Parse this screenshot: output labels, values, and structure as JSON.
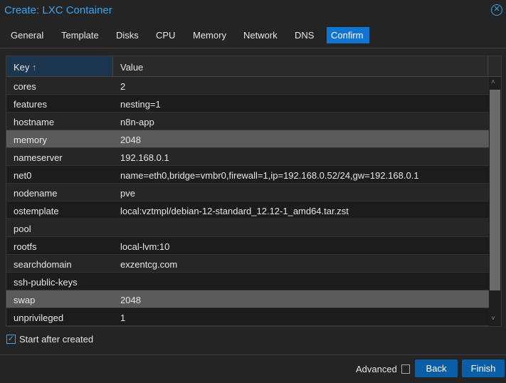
{
  "title": "Create: LXC Container",
  "tabs": [
    "General",
    "Template",
    "Disks",
    "CPU",
    "Memory",
    "Network",
    "DNS",
    "Confirm"
  ],
  "grid": {
    "key_header": "Key",
    "value_header": "Value",
    "sort_icon": "↑",
    "rows": [
      {
        "key": "cores",
        "value": "2"
      },
      {
        "key": "features",
        "value": "nesting=1"
      },
      {
        "key": "hostname",
        "value": "n8n-app"
      },
      {
        "key": "memory",
        "value": "2048",
        "selected": true
      },
      {
        "key": "nameserver",
        "value": "192.168.0.1"
      },
      {
        "key": "net0",
        "value": "name=eth0,bridge=vmbr0,firewall=1,ip=192.168.0.52/24,gw=192.168.0.1"
      },
      {
        "key": "nodename",
        "value": "pve"
      },
      {
        "key": "ostemplate",
        "value": "local:vztmpl/debian-12-standard_12.12-1_amd64.tar.zst"
      },
      {
        "key": "pool",
        "value": ""
      },
      {
        "key": "rootfs",
        "value": "local-lvm:10"
      },
      {
        "key": "searchdomain",
        "value": "exzentcg.com"
      },
      {
        "key": "ssh-public-keys",
        "value": ""
      },
      {
        "key": "swap",
        "value": "2048",
        "selected": true
      },
      {
        "key": "unprivileged",
        "value": "1"
      }
    ]
  },
  "start_after_created": {
    "label": "Start after created",
    "checked": true
  },
  "footer": {
    "advanced": "Advanced",
    "back": "Back",
    "finish": "Finish"
  }
}
